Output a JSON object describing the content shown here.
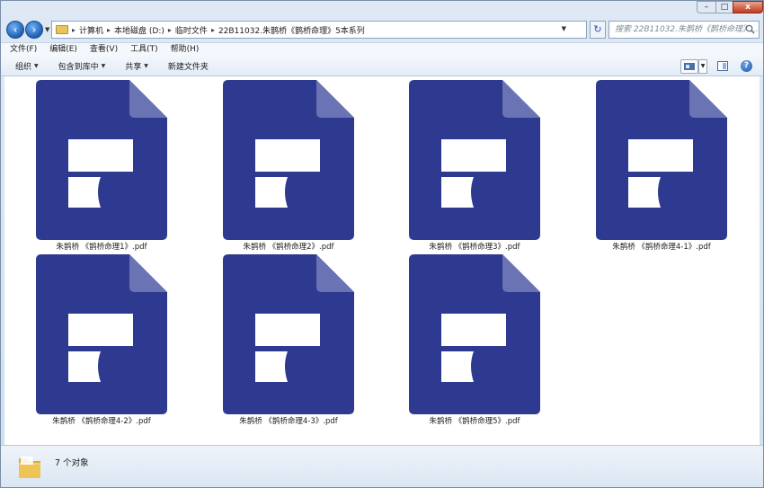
{
  "window": {
    "controls": {
      "minimize": "–",
      "maximize": "□",
      "close": "x"
    }
  },
  "address": {
    "breadcrumbs": [
      "计算机",
      "本地磁盘 (D:)",
      "临时文件",
      "22B11032.朱鹊桥《鹊桥命理》5本系列"
    ],
    "search_placeholder": "搜索 22B11032.朱鹊桥《鹊桥命理》..."
  },
  "menu": [
    "文件(F)",
    "编辑(E)",
    "查看(V)",
    "工具(T)",
    "帮助(H)"
  ],
  "toolbar": {
    "organize": "组织",
    "include_library": "包含到库中",
    "share": "共享",
    "new_folder": "新建文件夹"
  },
  "files": [
    {
      "name": "朱鹊桥 《鹊桥命理1》.pdf"
    },
    {
      "name": "朱鹊桥 《鹊桥命理2》.pdf"
    },
    {
      "name": "朱鹊桥 《鹊桥命理3》.pdf"
    },
    {
      "name": "朱鹊桥 《鹊桥命理4-1》.pdf"
    },
    {
      "name": "朱鹊桥 《鹊桥命理4-2》.pdf"
    },
    {
      "name": "朱鹊桥 《鹊桥命理4-3》.pdf"
    },
    {
      "name": "朱鹊桥 《鹊桥命理5》.pdf"
    }
  ],
  "status": {
    "count_text": "7 个对象"
  },
  "colors": {
    "pdf_icon": "#2e3a8f",
    "pdf_fold": "#6a73b4",
    "window_frame": "#cfdff0"
  }
}
